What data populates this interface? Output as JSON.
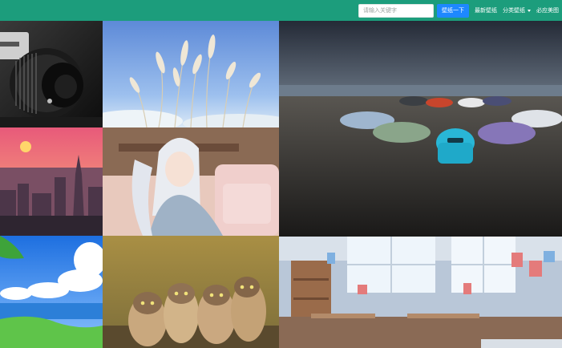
{
  "header": {
    "search": {
      "placeholder": "请输入关键字",
      "value": ""
    },
    "search_button_label": "壁纸一下",
    "nav": {
      "latest": "最新壁纸",
      "category": "分类壁纸",
      "must_see": "必应美图"
    }
  },
  "colors": {
    "topbar": "#1c9d7c",
    "search_button": "#1e88ff"
  },
  "gallery": {
    "tiles": [
      {
        "subject": "camera-lens"
      },
      {
        "subject": "reeds-blue-sky"
      },
      {
        "subject": "cars-on-beach"
      },
      {
        "subject": "city-sunset"
      },
      {
        "subject": "anime-girl-white-hair"
      },
      {
        "subject": "anime-seaside-clouds"
      },
      {
        "subject": "owls-on-branch"
      },
      {
        "subject": "anime-cluttered-room"
      }
    ]
  }
}
